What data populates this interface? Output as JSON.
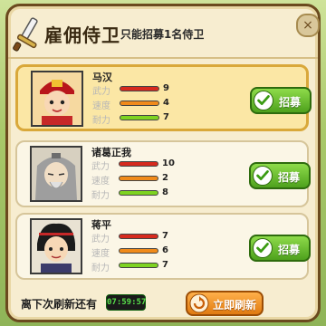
{
  "header": {
    "title": "雇佣侍卫",
    "subtitle": "只能招募1名侍卫",
    "close_icon": "close-icon"
  },
  "heroes": [
    {
      "name": "马汉",
      "selected": true,
      "stats": [
        {
          "label": "武力",
          "value": "9",
          "color": "#d62a1e"
        },
        {
          "label": "速度",
          "value": "4",
          "color": "#f08a1a"
        },
        {
          "label": "耐力",
          "value": "7",
          "color": "#7ed321"
        }
      ],
      "recruit_label": "招募"
    },
    {
      "name": "诸葛正我",
      "selected": false,
      "stats": [
        {
          "label": "武力",
          "value": "10",
          "color": "#d62a1e"
        },
        {
          "label": "速度",
          "value": "2",
          "color": "#f08a1a"
        },
        {
          "label": "耐力",
          "value": "8",
          "color": "#7ed321"
        }
      ],
      "recruit_label": "招募"
    },
    {
      "name": "蒋平",
      "selected": false,
      "stats": [
        {
          "label": "武力",
          "value": "7",
          "color": "#d62a1e"
        },
        {
          "label": "速度",
          "value": "6",
          "color": "#f08a1a"
        },
        {
          "label": "耐力",
          "value": "7",
          "color": "#7ed321"
        }
      ],
      "recruit_label": "招募"
    }
  ],
  "footer": {
    "refresh_text": "离下次刷新还有",
    "timer": "07:59:57",
    "refresh_button_label": "立即刷新"
  },
  "colors": {
    "accent_green": "#4ea11d",
    "accent_orange": "#e07a10",
    "selected_border": "#d9a83a"
  }
}
